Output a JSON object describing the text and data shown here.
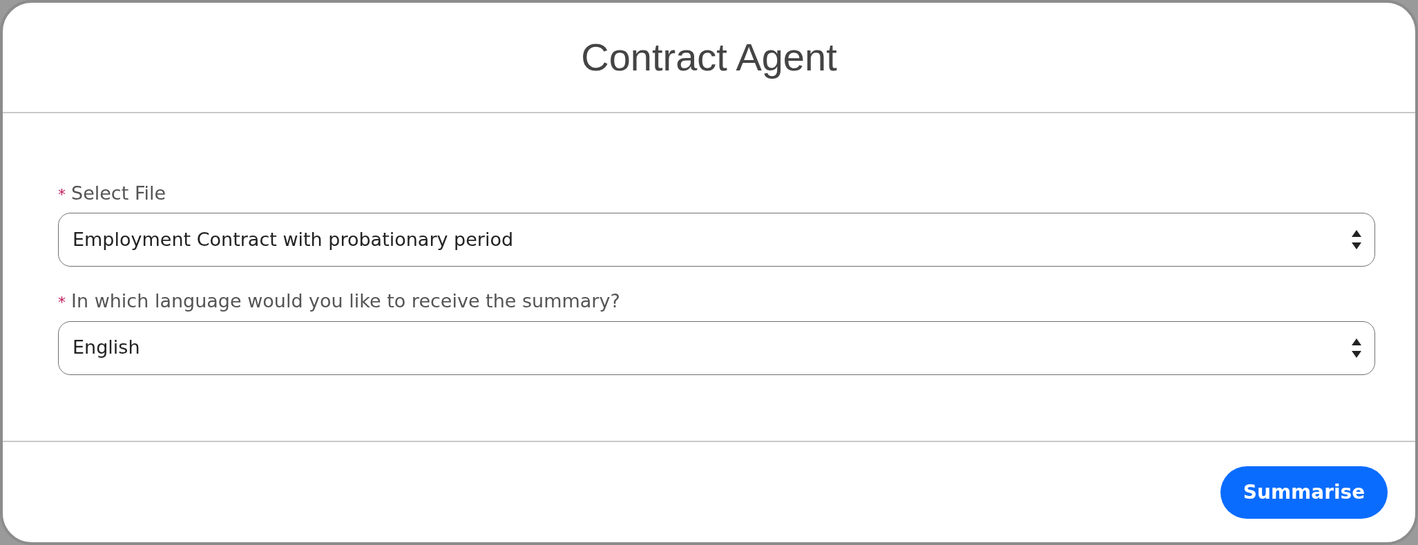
{
  "dialog": {
    "title": "Contract Agent"
  },
  "fields": [
    {
      "label": "Select File",
      "required": true,
      "required_mark": "*",
      "value": "Employment Contract with probationary period"
    },
    {
      "label": "In which language would you like to receive the summary?",
      "required": true,
      "required_mark": "*",
      "value": "English"
    }
  ],
  "buttons": [
    {
      "label": "Summarise",
      "kind": "primary"
    }
  ]
}
